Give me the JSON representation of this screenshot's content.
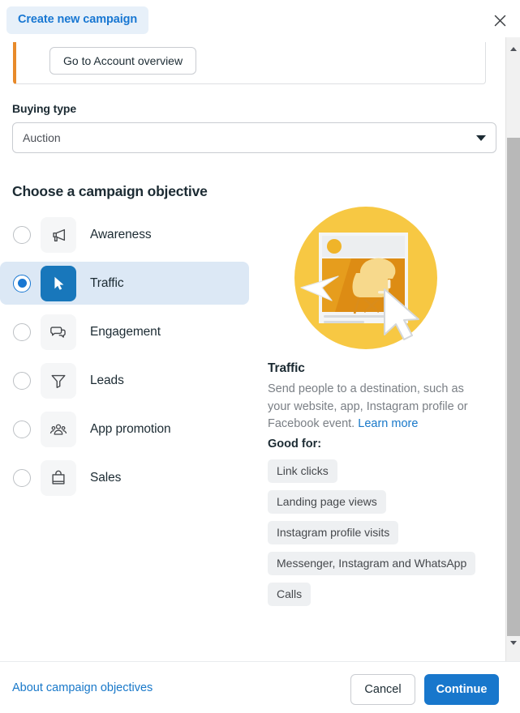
{
  "header": {
    "tab_label": "Create new campaign",
    "close_icon": "close-icon"
  },
  "alert": {
    "button_label": "Go to Account overview",
    "accent_color": "#e88a2a"
  },
  "buying_type": {
    "label": "Buying type",
    "selected_value": "Auction",
    "options": [
      "Auction"
    ]
  },
  "objectives": {
    "section_title": "Choose a campaign objective",
    "items": [
      {
        "label": "Awareness",
        "icon": "megaphone-icon",
        "selected": false
      },
      {
        "label": "Traffic",
        "icon": "cursor-arrow-icon",
        "selected": true
      },
      {
        "label": "Engagement",
        "icon": "speech-bubbles-icon",
        "selected": false
      },
      {
        "label": "Leads",
        "icon": "funnel-icon",
        "selected": false
      },
      {
        "label": "App promotion",
        "icon": "people-group-icon",
        "selected": false
      },
      {
        "label": "Sales",
        "icon": "shopping-bag-icon",
        "selected": false
      }
    ]
  },
  "detail": {
    "illustration": "traffic-illustration",
    "title": "Traffic",
    "description": "Send people to a destination, such as your website, app, Instagram profile or Facebook event.",
    "learn_more_label": "Learn more",
    "good_for_title": "Good for:",
    "good_for_items": [
      "Link clicks",
      "Landing page views",
      "Instagram profile visits",
      "Messenger, Instagram and WhatsApp",
      "Calls"
    ]
  },
  "footer": {
    "about_link": "About campaign objectives",
    "cancel_label": "Cancel",
    "continue_label": "Continue",
    "primary_color": "#1877cc"
  },
  "scrollbar": {
    "position": "right",
    "thumb_visible": true
  }
}
